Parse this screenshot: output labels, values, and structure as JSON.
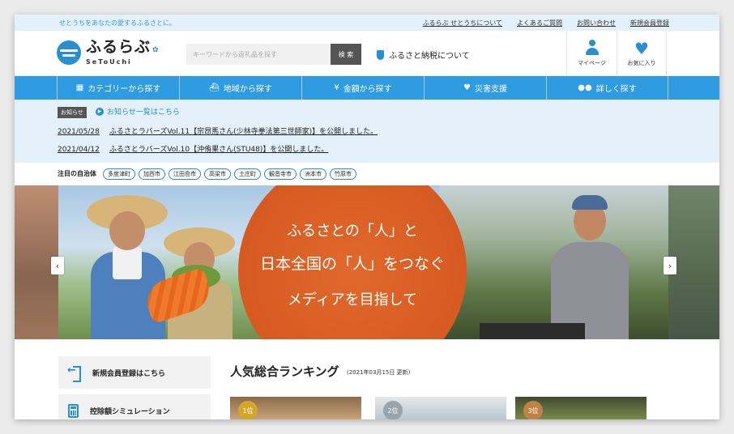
{
  "topbar": {
    "tagline": "せとうちをあなたの愛するふるさとに。",
    "links": [
      "ふるらぶ せとうちについて",
      "よくあるご質問",
      "お問い合わせ",
      "新規会員登録"
    ]
  },
  "header": {
    "logo_main": "ふるらぶ",
    "logo_sub": "SeToUchi",
    "search_placeholder": "キーワードから返礼品を探す",
    "search_button": "検 索",
    "furusato_link": "ふるさと納税について",
    "mypage_label": "マイページ",
    "favorites_label": "お気に入り"
  },
  "nav": {
    "items": [
      {
        "label": "カテゴリーから探す",
        "icon": "grid-icon"
      },
      {
        "label": "地域から探す",
        "icon": "ship-icon"
      },
      {
        "label": "金額から探す",
        "icon": "money-bag-icon"
      },
      {
        "label": "災害支援",
        "icon": "handshake-icon"
      },
      {
        "label": "詳しく探す",
        "icon": "binoculars-icon"
      }
    ]
  },
  "news": {
    "badge": "お知らせ",
    "all_link": "お知らせ一覧はこちら",
    "items": [
      {
        "date": "2021/05/28",
        "text": "ふるさとラバーズVol.11【宗昂馬さん(少林寺拳法第三世師家)】を公開しました。"
      },
      {
        "date": "2021/04/12",
        "text": "ふるさとラバーズVol.10【沖侑果さん(STU48)】を公開しました。"
      }
    ]
  },
  "featured": {
    "label": "注目の自治体",
    "cities": [
      "多度津町",
      "加西市",
      "江田島市",
      "高梁市",
      "土庄町",
      "観音寺市",
      "洲本市",
      "竹原市"
    ]
  },
  "hero": {
    "line1": "ふるさとの「人」と",
    "line2": "日本全国の「人」をつなぐ",
    "line3": "メディアを目指して",
    "prev_label": "‹",
    "next_label": "›"
  },
  "sidebar": {
    "register": "新規会員登録はこちら",
    "simulation": "控除額シミュレーション"
  },
  "ranking": {
    "title": "人気総合ランキング",
    "date": "(2021年03月15日 更新)",
    "ranks": [
      "1位",
      "2位",
      "3位"
    ]
  },
  "colors": {
    "primary": "#2f9be0",
    "light_bg": "#e4f1fa",
    "hero_orange": "#d65a22"
  }
}
